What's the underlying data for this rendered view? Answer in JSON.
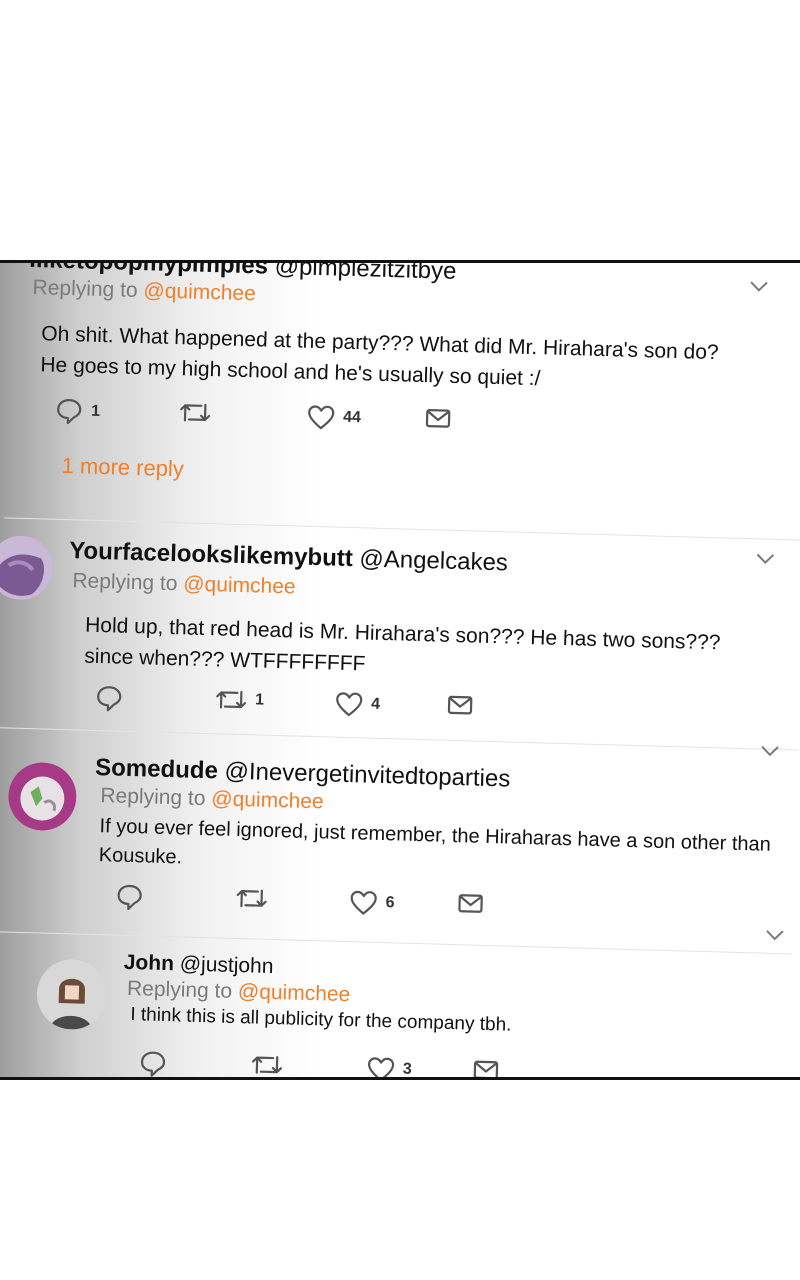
{
  "tweets": [
    {
      "name": "Iliketopopmypimples",
      "handle": "@pimplezitzitbye",
      "replying_prefix": "Replying to",
      "replying_to": "@quimchee",
      "lines": [
        "Oh shit. What happened at the party??? What did Mr. Hirahara's son do?",
        "He goes to my high school and he's usually so quiet :/"
      ],
      "replies": "1",
      "retweets": "",
      "likes": "44",
      "more_replies": "1 more reply"
    },
    {
      "name": "Yourfacelookslikemybutt",
      "handle": "@Angelcakes",
      "replying_prefix": "Replying to",
      "replying_to": "@quimchee",
      "lines": [
        "Hold up, that red head is Mr. Hirahara's son??? He has two sons???",
        "since when??? WTFFFFFFFF"
      ],
      "replies": "",
      "retweets": "1",
      "likes": "4"
    },
    {
      "name": "Somedude",
      "handle": "@Inevergetinvitedtoparties",
      "replying_prefix": "Replying to",
      "replying_to": "@quimchee",
      "lines": [
        "If you ever feel ignored, just remember, the Hiraharas have a son other than",
        "Kousuke."
      ],
      "replies": "",
      "retweets": "",
      "likes": "6"
    },
    {
      "name": "John",
      "handle": "@justjohn",
      "replying_prefix": "Replying to",
      "replying_to": "@quimchee",
      "lines": [
        "I think this is all publicity for the company tbh."
      ],
      "replies": "",
      "retweets": "",
      "likes": "3"
    }
  ],
  "icons": {
    "reply": "speech-bubble-icon",
    "retweet": "retweet-arrows-icon",
    "like": "heart-icon",
    "dm": "envelope-icon",
    "menu": "chevron-down-icon"
  },
  "colors": {
    "accent": "#f07f2a",
    "muted": "#7a7a7a",
    "divider": "#e3e3e3"
  }
}
